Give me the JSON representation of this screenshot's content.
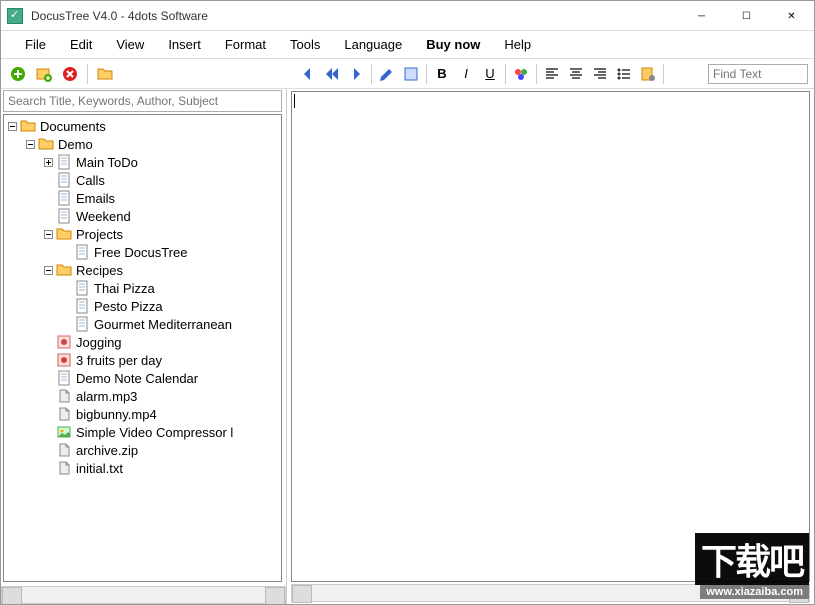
{
  "window": {
    "title": "DocusTree V4.0 - 4dots Software"
  },
  "menu": [
    "File",
    "Edit",
    "View",
    "Insert",
    "Format",
    "Tools",
    "Language",
    "Buy now",
    "Help"
  ],
  "menu_bold": "Buy now",
  "search": {
    "placeholder": "Search Title, Keywords, Author, Subject"
  },
  "find": {
    "placeholder": "Find Text"
  },
  "tree": {
    "root": {
      "label": "Documents",
      "icon": "folder",
      "expanded": true,
      "children": [
        {
          "label": "Demo",
          "icon": "folder",
          "expanded": true,
          "children": [
            {
              "label": "Main ToDo",
              "icon": "doc",
              "hasChildren": true,
              "expanded": false
            },
            {
              "label": "Calls",
              "icon": "doc"
            },
            {
              "label": "Emails",
              "icon": "doc"
            },
            {
              "label": "Weekend",
              "icon": "doc"
            },
            {
              "label": "Projects",
              "icon": "folder",
              "expanded": true,
              "children": [
                {
                  "label": "Free DocusTree",
                  "icon": "doc"
                }
              ]
            },
            {
              "label": "Recipes",
              "icon": "folder",
              "expanded": true,
              "children": [
                {
                  "label": "Thai Pizza",
                  "icon": "doc"
                },
                {
                  "label": "Pesto Pizza",
                  "icon": "doc"
                },
                {
                  "label": "Gourmet Mediterranean",
                  "icon": "doc"
                }
              ]
            },
            {
              "label": "Jogging",
              "icon": "activity"
            },
            {
              "label": "3 fruits per day",
              "icon": "activity"
            },
            {
              "label": "Demo Note Calendar",
              "icon": "doc"
            },
            {
              "label": "alarm.mp3",
              "icon": "file"
            },
            {
              "label": "bigbunny.mp4",
              "icon": "file"
            },
            {
              "label": "Simple Video Compressor l",
              "icon": "image"
            },
            {
              "label": "archive.zip",
              "icon": "file"
            },
            {
              "label": "initial.txt",
              "icon": "file"
            }
          ]
        }
      ]
    }
  },
  "watermark": {
    "text": "下载吧",
    "url": "www.xiazaiba.com"
  }
}
